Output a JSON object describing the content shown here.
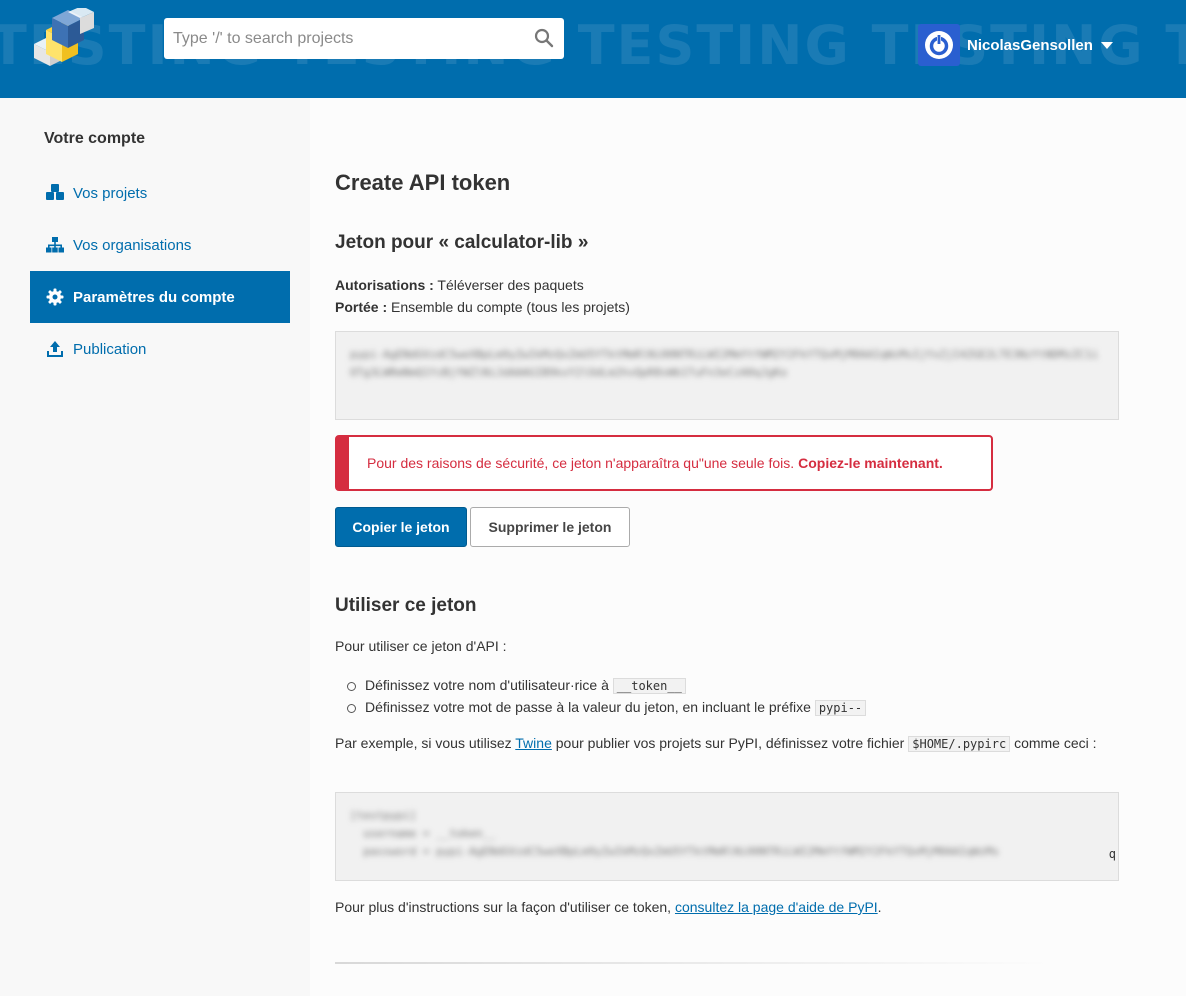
{
  "header": {
    "watermark": "TESTING TESTING TESTING TESTING TESTING TESTING",
    "search": {
      "placeholder": "Type '/' to search projects"
    },
    "user": {
      "name": "NicolasGensollen"
    }
  },
  "sidebar": {
    "title": "Votre compte",
    "items": [
      {
        "label": "Vos projets",
        "icon": "cubes-icon",
        "active": false
      },
      {
        "label": "Vos organisations",
        "icon": "sitemap-icon",
        "active": false
      },
      {
        "label": "Paramètres du compte",
        "icon": "gear-icon",
        "active": true
      },
      {
        "label": "Publication",
        "icon": "upload-icon",
        "active": false
      }
    ]
  },
  "main": {
    "title": "Create API token",
    "token_heading": "Jeton pour « calculator-lib »",
    "permissions_label": "Autorisations :",
    "permissions_value": "Téléverser des paquets",
    "scope_label": "Portée :",
    "scope_value": "Ensemble du compte (tous les projets)",
    "token_value": "pypi-AgENdGVzdC5weXBpLm9yZwIkMzQxZmU5YTktMmRlNi00NTRiLWI2MmYtYWM2Y2FkYTQxMjM0AAIqWzMsIjYxZjI4ZGE2LTE3NzYtNDMzZC1iOTg3LWRmNmQ1YzBjYWZlNiJdAAAGIB9kxY2lOdLm2hvQpR8sWb1TuFn3eCzA0qJgKo",
    "alert_text": "Pour des raisons de sécurité, ce jeton n'apparaîtra qu\"une seule fois.",
    "alert_strong": "Copiez-le maintenant.",
    "copy_button": "Copier le jeton",
    "delete_button": "Supprimer le jeton",
    "use_heading": "Utiliser ce jeton",
    "use_intro": "Pour utiliser ce jeton d'API :",
    "step1_text": "Définissez votre nom d'utilisateur·rice à",
    "step1_code": "__token__",
    "step2_text": "Définissez votre mot de passe à la valeur du jeton, en incluant le préfixe",
    "step2_code": "pypi--",
    "example_pre": "Par exemple, si vous utilisez",
    "example_link": "Twine",
    "example_mid": "pour publier vos projets sur PyPI, définissez votre fichier",
    "example_code": "$HOME/.pypirc",
    "example_post": "comme ceci :",
    "config_lines": "[testpypi]\n  username = __token__\n  password = pypi-AgENdGVzdC5weXBpLm9yZwIkMzQxZmU5YTktMmRlNi00NTRiLWI2MmYtYWM2Y2FkYTQxMjM0AAIqWzMs",
    "config_edge": "q",
    "help_pre": "Pour plus d'instructions sur la façon d'utiliser ce token,",
    "help_link": "consultez la page d'aide de PyPI",
    "help_post": "."
  },
  "colors": {
    "brand": "#006dad",
    "alert": "#d52d40",
    "sidebar_bg": "#f8f8f8"
  }
}
